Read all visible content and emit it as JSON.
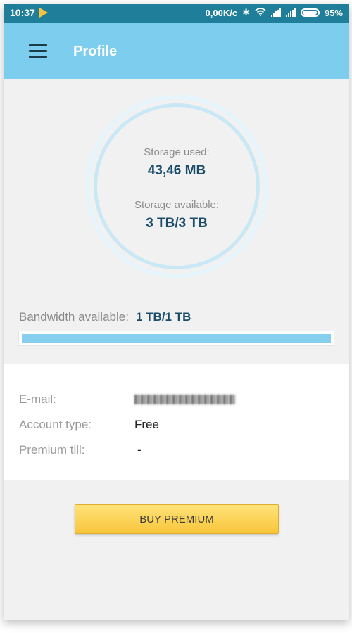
{
  "status_bar": {
    "time": "10:37",
    "network_speed": "0,00K/c",
    "battery": "95%",
    "icons": [
      "play-store-icon",
      "bluetooth-icon",
      "wifi-icon",
      "signal-icon",
      "signal-icon",
      "battery-icon"
    ]
  },
  "app_bar": {
    "title": "Profile",
    "color": "#7ccdee"
  },
  "storage": {
    "used_label": "Storage used:",
    "used_value": "43,46 MB",
    "available_label": "Storage available:",
    "available_value": "3 TB/3 TB"
  },
  "bandwidth": {
    "label": "Bandwidth available:",
    "value": "1 TB/1 TB",
    "fill_fraction": 1.0
  },
  "account": {
    "email_label": "E-mail:",
    "account_type_label": "Account type:",
    "account_type_value": "Free",
    "premium_till_label": "Premium till:",
    "premium_till_value": "-"
  },
  "buy_button_label": "BUY PREMIUM"
}
